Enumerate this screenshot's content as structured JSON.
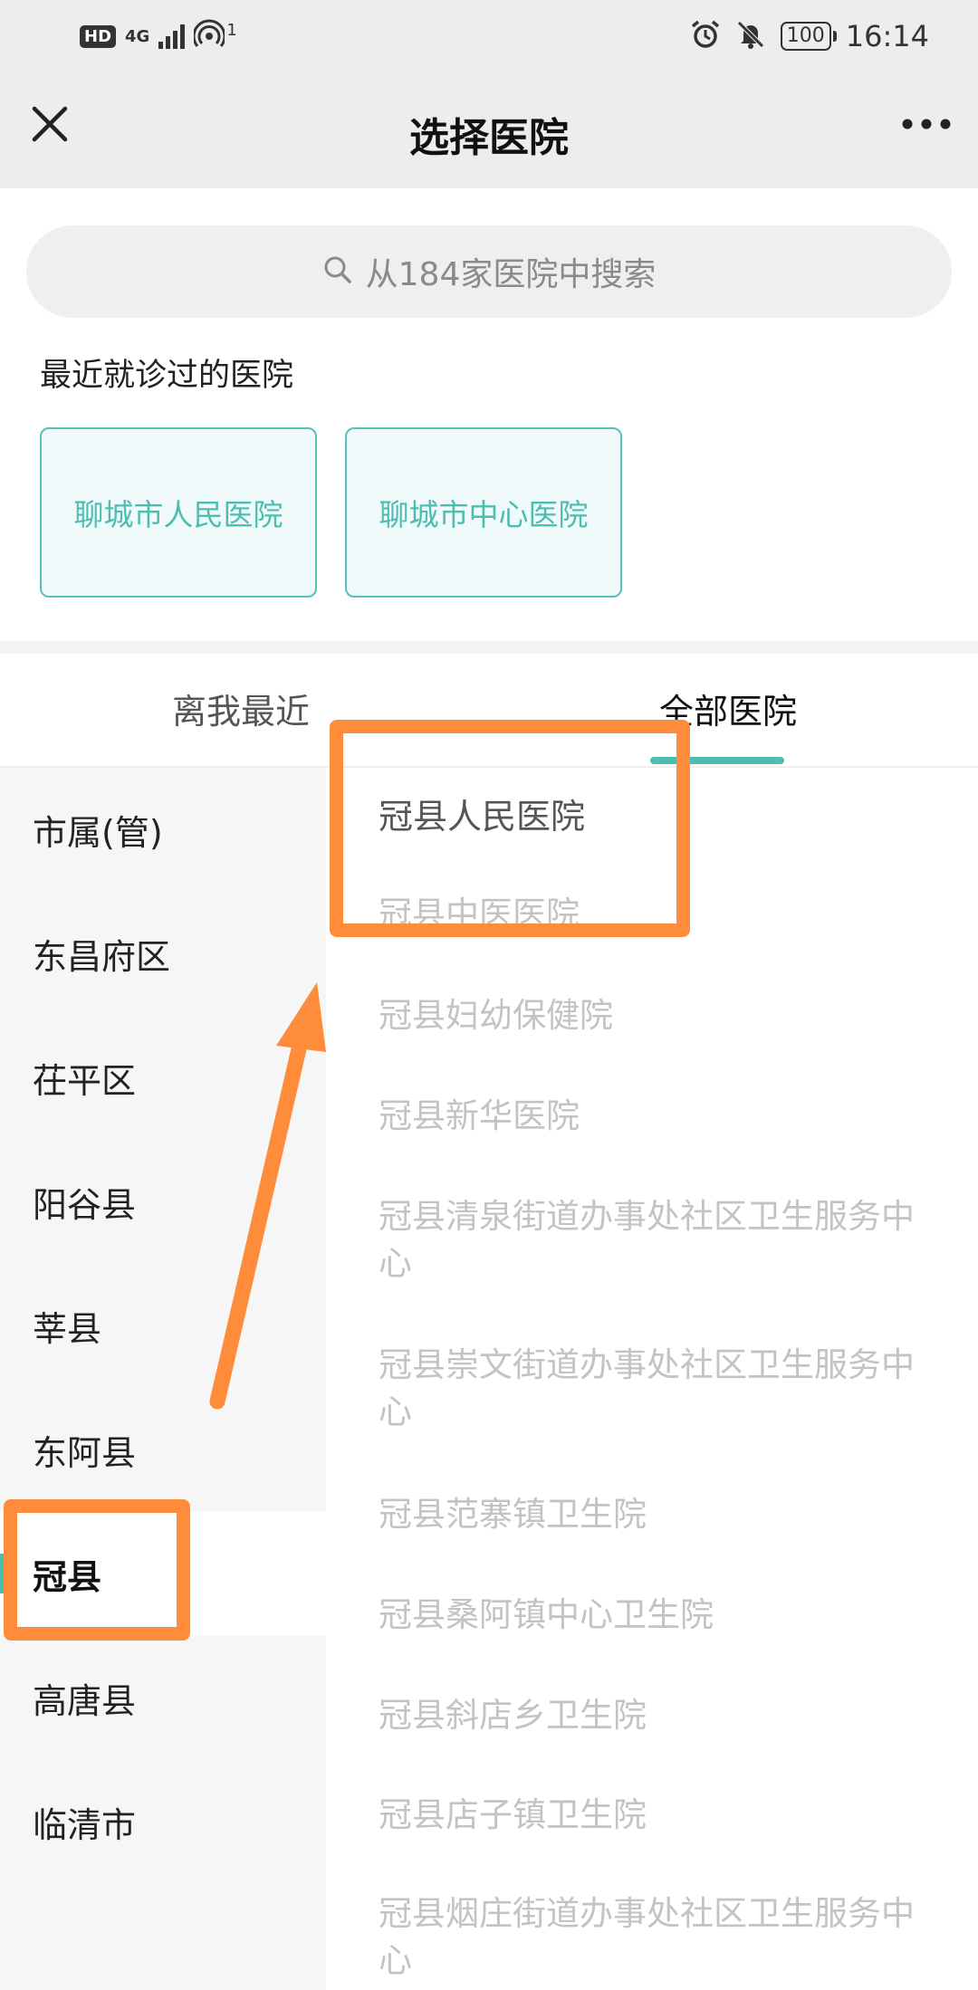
{
  "status_bar": {
    "hd": "HD",
    "network": "4G",
    "hotspot_count": "1",
    "battery": "100",
    "time": "16:14"
  },
  "nav": {
    "title": "选择医院"
  },
  "search": {
    "placeholder": "从184家医院中搜索"
  },
  "recent": {
    "title": "最近就诊过的医院",
    "hospitals": [
      "聊城市人民医院",
      "聊城市中心医院"
    ]
  },
  "tabs": {
    "near": "离我最近",
    "all": "全部医院",
    "selected": "全部医院"
  },
  "districts": [
    "市属(管)",
    "东昌府区",
    "茌平区",
    "阳谷县",
    "莘县",
    "东阿县",
    "冠县",
    "高唐县",
    "临清市"
  ],
  "selected_district": "冠县",
  "hospitals": [
    "冠县人民医院",
    "冠县中医医院",
    "冠县妇幼保健院",
    "冠县新华医院",
    "冠县清泉街道办事处社区卫生服务中心",
    "冠县崇文街道办事处社区卫生服务中心",
    "冠县范寨镇卫生院",
    "冠县桑阿镇中心卫生院",
    "冠县斜店乡卫生院",
    "冠县店子镇卫生院",
    "冠县烟庄街道办事处社区卫生服务中心"
  ],
  "colors": {
    "accent": "#4dbdb1",
    "annotation": "#ff8c3a"
  }
}
